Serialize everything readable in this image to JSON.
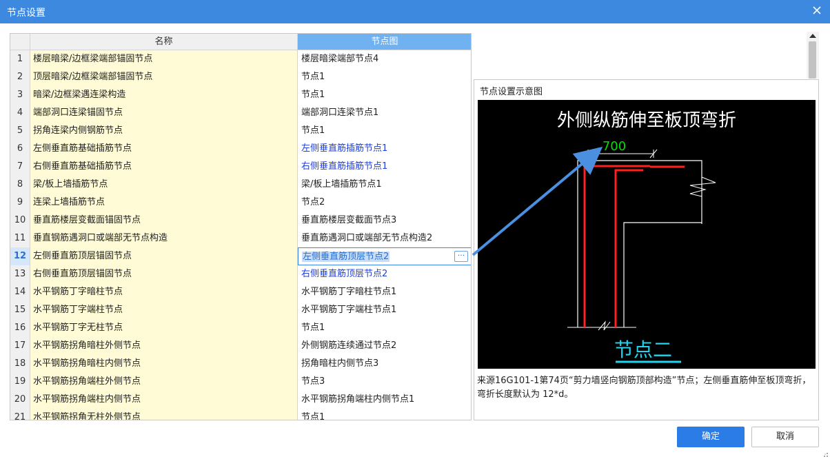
{
  "window": {
    "title": "节点设置"
  },
  "grid": {
    "headers": {
      "name": "名称",
      "node": "节点图"
    },
    "rows": [
      {
        "num": "1",
        "name": "楼层暗梁/边框梁端部锚固节点",
        "node": "楼层暗梁端部节点4",
        "blue": false
      },
      {
        "num": "2",
        "name": "顶层暗梁/边框梁端部锚固节点",
        "node": "节点1",
        "blue": false
      },
      {
        "num": "3",
        "name": "暗梁/边框梁遇连梁构造",
        "node": "节点1",
        "blue": false
      },
      {
        "num": "4",
        "name": "端部洞口连梁锚固节点",
        "node": "端部洞口连梁节点1",
        "blue": false
      },
      {
        "num": "5",
        "name": "拐角连梁内侧钢筋节点",
        "node": "节点1",
        "blue": false
      },
      {
        "num": "6",
        "name": "左侧垂直筋基础插筋节点",
        "node": "左侧垂直筋插筋节点1",
        "blue": true
      },
      {
        "num": "7",
        "name": "右侧垂直筋基础插筋节点",
        "node": "右侧垂直筋插筋节点1",
        "blue": true
      },
      {
        "num": "8",
        "name": "梁/板上墙插筋节点",
        "node": "梁/板上墙插筋节点1",
        "blue": false
      },
      {
        "num": "9",
        "name": "连梁上墙插筋节点",
        "node": "节点2",
        "blue": false
      },
      {
        "num": "10",
        "name": "垂直筋楼层变截面锚固节点",
        "node": "垂直筋楼层变截面节点3",
        "blue": false
      },
      {
        "num": "11",
        "name": "垂直钢筋遇洞口或端部无节点构造",
        "node": "垂直筋遇洞口或端部无节点构造2",
        "blue": false
      },
      {
        "num": "12",
        "name": "左侧垂直筋顶层锚固节点",
        "node": "左侧垂直筋顶层节点2",
        "blue": true,
        "selected": true
      },
      {
        "num": "13",
        "name": "右侧垂直筋顶层锚固节点",
        "node": "右侧垂直筋顶层节点2",
        "blue": true
      },
      {
        "num": "14",
        "name": "水平钢筋丁字暗柱节点",
        "node": "水平钢筋丁字暗柱节点1",
        "blue": false
      },
      {
        "num": "15",
        "name": "水平钢筋丁字端柱节点",
        "node": "水平钢筋丁字端柱节点1",
        "blue": false
      },
      {
        "num": "16",
        "name": "水平钢筋丁字无柱节点",
        "node": "节点1",
        "blue": false
      },
      {
        "num": "17",
        "name": "水平钢筋拐角暗柱外侧节点",
        "node": "外侧钢筋连续通过节点2",
        "blue": false
      },
      {
        "num": "18",
        "name": "水平钢筋拐角暗柱内侧节点",
        "node": "拐角暗柱内侧节点3",
        "blue": false
      },
      {
        "num": "19",
        "name": "水平钢筋拐角端柱外侧节点",
        "node": "节点3",
        "blue": false
      },
      {
        "num": "20",
        "name": "水平钢筋拐角端柱内侧节点",
        "node": "水平钢筋拐角端柱内侧节点1",
        "blue": false
      },
      {
        "num": "21",
        "name": "水平钢筋拐角无柱外侧节点",
        "node": "节点1",
        "blue": false
      }
    ]
  },
  "preview": {
    "title": "节点设置示意图",
    "diagram_title": "外侧纵筋伸至板顶弯折",
    "dimension": "700",
    "node_label": "节点二",
    "description": "来源16G101-1第74页“剪力墙竖向钢筋顶部构造”节点；左侧垂直筋伸至板顶弯折，弯折长度默认为 12*d。"
  },
  "buttons": {
    "ok": "确定",
    "cancel": "取消"
  },
  "colors": {
    "titlebar": "#3d89e0",
    "header_active": "#6fb1f1",
    "name_cell": "#fffbd6",
    "link_blue": "#1f3fdc",
    "primary_button": "#2c7ce8"
  },
  "icons": {
    "close": "close-icon",
    "ellipsis": "ellipsis-icon",
    "scroll_up": "scroll-up-icon",
    "resize": "resize-grip-icon"
  }
}
